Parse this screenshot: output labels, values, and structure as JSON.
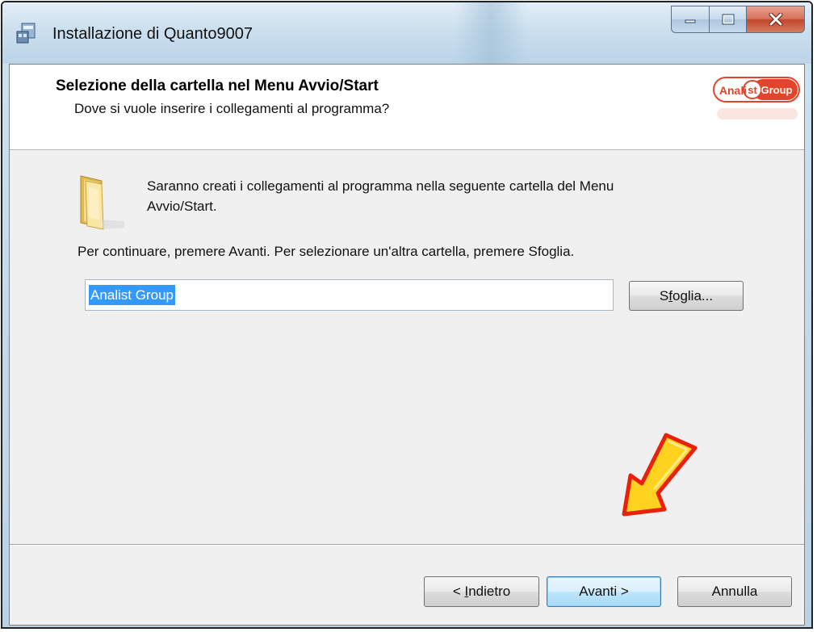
{
  "window": {
    "title": "Installazione di Quanto9007",
    "controls": [
      "minimize",
      "maximize",
      "close"
    ]
  },
  "header": {
    "title": "Selezione della cartella nel Menu Avvio/Start",
    "subtitle": "Dove si vuole inserire i collegamenti al programma?",
    "logo_text": "AnalistGroup"
  },
  "body": {
    "info_line1": "Saranno creati i collegamenti al programma nella seguente cartella del Menu",
    "info_line2": "Avvio/Start.",
    "instruction": "Per continuare, premere Avanti. Per selezionare un'altra cartella, premere Sfoglia.",
    "folder_value": "Analist Group"
  },
  "buttons": {
    "browse": "Sfoglia...",
    "back": "< Indietro",
    "next": "Avanti >",
    "cancel": "Annulla"
  },
  "colors": {
    "selection": "#3399ff",
    "arrow_fill": "#ffd21f",
    "arrow_outline": "#e8200c"
  }
}
